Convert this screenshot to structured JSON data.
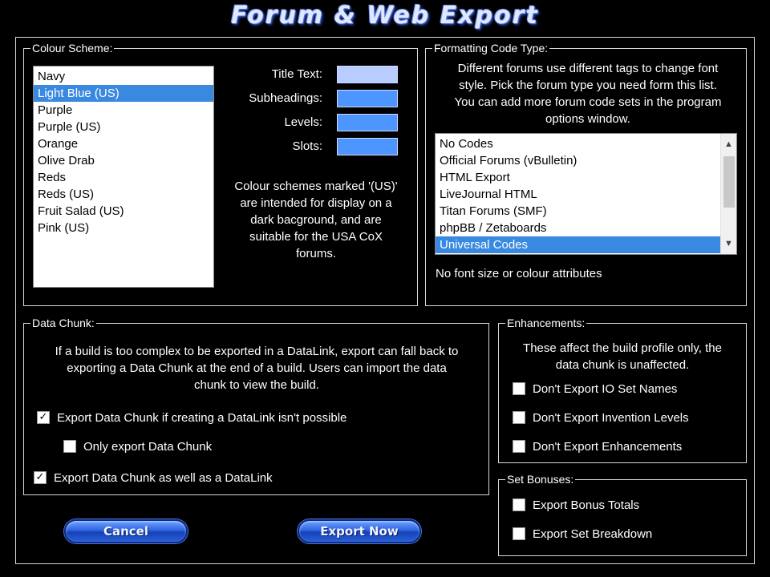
{
  "window": {
    "title": "Forum & Web Export"
  },
  "colour_scheme": {
    "legend": "Colour Scheme:",
    "items": [
      "Navy",
      "Light Blue (US)",
      "Purple",
      "Purple (US)",
      "Orange",
      "Olive Drab",
      "Reds",
      "Reds (US)",
      "Fruit Salad (US)",
      "Pink (US)"
    ],
    "selected_index": 1,
    "swatches": [
      {
        "label": "Title Text:",
        "color": "#b8ccff"
      },
      {
        "label": "Subheadings:",
        "color": "#4d96ff"
      },
      {
        "label": "Levels:",
        "color": "#4d96ff"
      },
      {
        "label": "Slots:",
        "color": "#4d96ff"
      }
    ],
    "note_lines": [
      "Colour schemes marked '(US)'",
      "are intended for display on a",
      "dark bacground, and are",
      "suitable for the USA CoX",
      "forums."
    ]
  },
  "formatting": {
    "legend": "Formatting Code Type:",
    "description_lines": [
      "Different forums use different tags to change font",
      "style. Pick the forum type you need form this list.",
      "You can add more forum code sets in the program",
      "options window."
    ],
    "items": [
      "No Codes",
      "Official Forums (vBulletin)",
      "HTML Export",
      "LiveJournal HTML",
      "Titan Forums (SMF)",
      "phpBB / Zetaboards",
      "Universal Codes"
    ],
    "selected_index": 6,
    "status": "No font size or colour attributes"
  },
  "data_chunk": {
    "legend": "Data Chunk:",
    "description_lines": [
      "If a build is too complex to be exported in a DataLink, export can fall back to",
      "exporting a Data Chunk at the end of a build. Users can import the data",
      "chunk to view the build."
    ],
    "options": [
      {
        "label": "Export Data Chunk if creating a DataLink isn't possible",
        "checked": true
      },
      {
        "label": "Only export Data Chunk",
        "checked": false
      },
      {
        "label": "Export Data Chunk as well as a DataLink",
        "checked": true
      }
    ]
  },
  "enhancements": {
    "legend": "Enhancements:",
    "description_lines": [
      "These affect the build profile only, the",
      "data chunk is unaffected."
    ],
    "options": [
      {
        "label": "Don't Export IO Set Names",
        "checked": false
      },
      {
        "label": "Don't Export Invention Levels",
        "checked": false
      },
      {
        "label": "Don't Export Enhancements",
        "checked": false
      }
    ]
  },
  "set_bonuses": {
    "legend": "Set Bonuses:",
    "options": [
      {
        "label": "Export Bonus Totals",
        "checked": false
      },
      {
        "label": "Export Set Breakdown",
        "checked": false
      }
    ]
  },
  "buttons": {
    "cancel": "Cancel",
    "export": "Export Now"
  },
  "icons": {
    "check": "✓",
    "scroll_up": "chevron-up-icon",
    "scroll_down": "chevron-down-icon"
  }
}
